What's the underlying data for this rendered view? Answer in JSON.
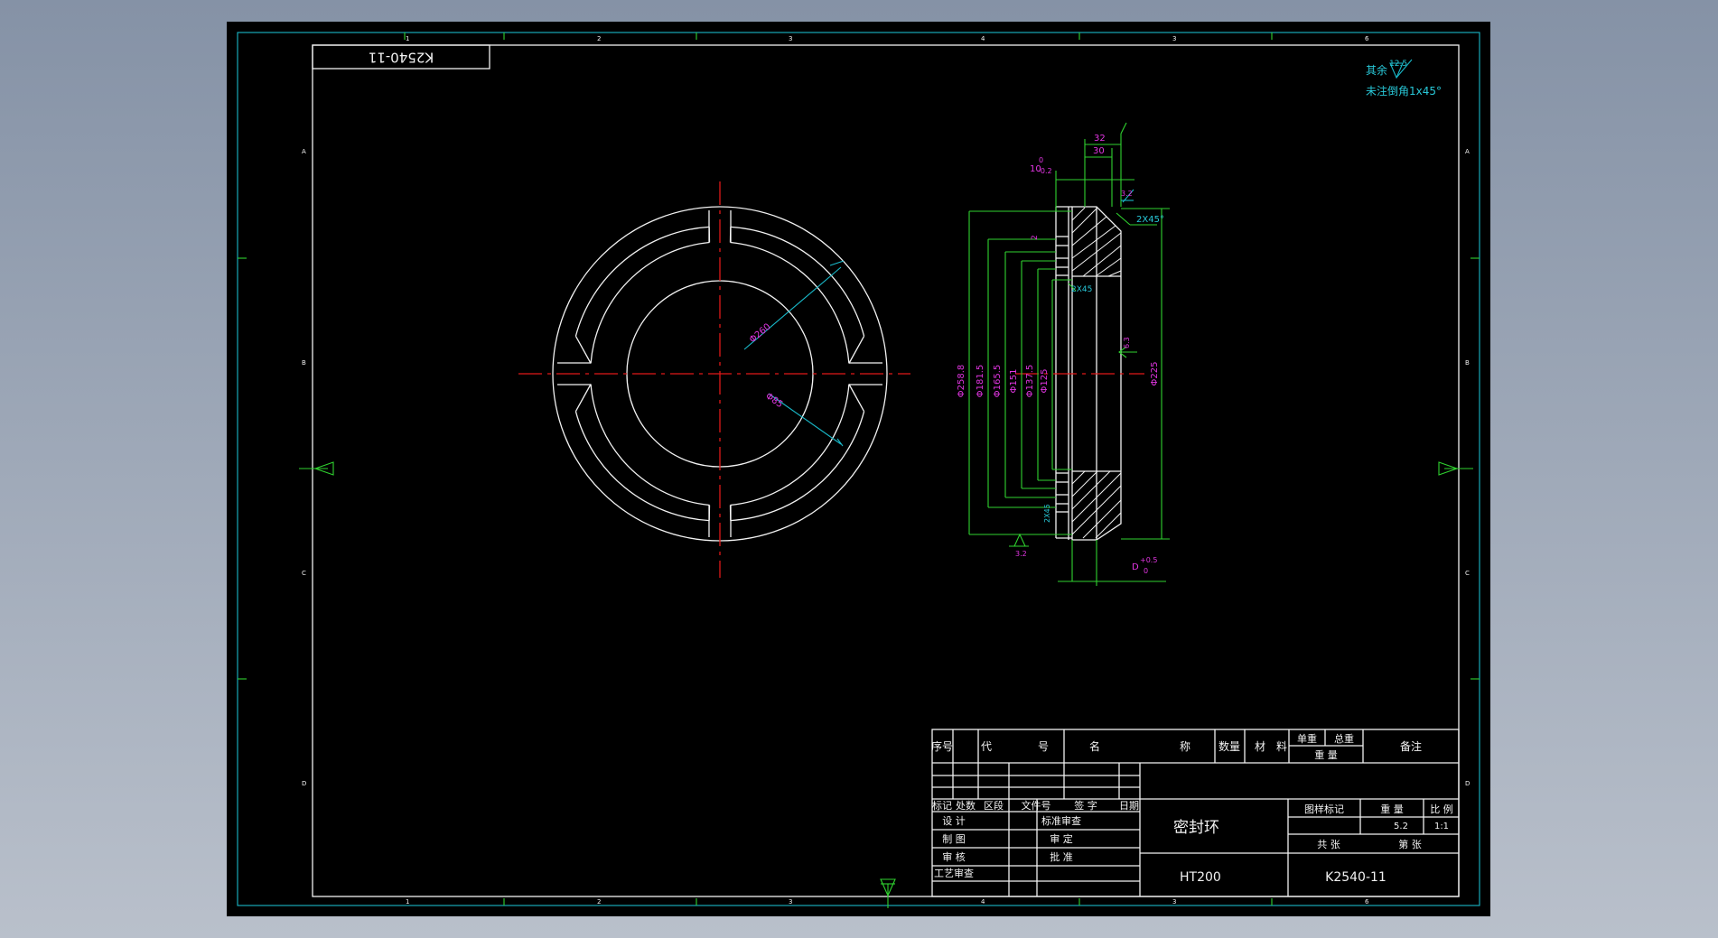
{
  "drawing_number_top": "K2540-11",
  "notes": {
    "surface_prefix": "其余",
    "roughness_value": "12.5",
    "chamfer_note": "未注倒角1x45°"
  },
  "front_view": {
    "dim_outer": "Φ260",
    "dim_inner": "Φ85"
  },
  "section_view": {
    "dim_32": "32",
    "dim_30": "30",
    "dim_10": "10",
    "tol_10_upper": "0",
    "tol_10_lower": "-0.2",
    "dim_2_top": "2",
    "rough_3_2_top": "3.2",
    "chamfer_2x45_a": "2X45°",
    "chamfer_2x45_b": "2X45",
    "chamfer_2x45_c": "2X45",
    "dia_labels": [
      "Φ258.8",
      "Φ181.5",
      "Φ165.5",
      "Φ151",
      "Φ137.5",
      "Φ125"
    ],
    "dia_225": "Φ225",
    "rough_6_3": "6.3",
    "rough_3_2_bottom": "3.2",
    "dim_d": "D",
    "tol_d_upper": "+0.5",
    "tol_d_lower": "0"
  },
  "title_block": {
    "hdr_seq": "序号",
    "hdr_code_a": "代",
    "hdr_code_b": "号",
    "hdr_name_a": "名",
    "hdr_name_b": "称",
    "hdr_qty": "数量",
    "hdr_mat_a": "材",
    "hdr_mat_b": "料",
    "hdr_unit_weight": "单重",
    "hdr_total_weight": "总重",
    "hdr_weight": "重 量",
    "hdr_remark": "备注",
    "rev_mark": "标记",
    "rev_count": "处数",
    "rev_zone": "区段",
    "rev_docno": "文件号",
    "rev_sign": "签 字",
    "rev_date": "日期",
    "role_design": "设 计",
    "role_draw": "制 图",
    "role_check": "审 核",
    "role_process": "工艺审查",
    "role_std": "标准审查",
    "role_review": "审 定",
    "role_approve": "批 准",
    "part_name": "密封环",
    "material": "HT200",
    "drawing_number": "K2540-11",
    "hdr_stage": "图样标记",
    "hdr_weight2": "重 量",
    "hdr_scale": "比 例",
    "weight_value": "5.2",
    "scale_value": "1:1",
    "sheets_total": "共 张",
    "sheet_no": "第 张"
  },
  "border_marks": {
    "top_numbers": [
      "1",
      "2",
      "3",
      "4",
      "3",
      "6"
    ],
    "bottom_numbers": [
      "1",
      "2",
      "3",
      "4",
      "3",
      "6"
    ],
    "side_letters": [
      "A",
      "B",
      "C",
      "D"
    ]
  }
}
